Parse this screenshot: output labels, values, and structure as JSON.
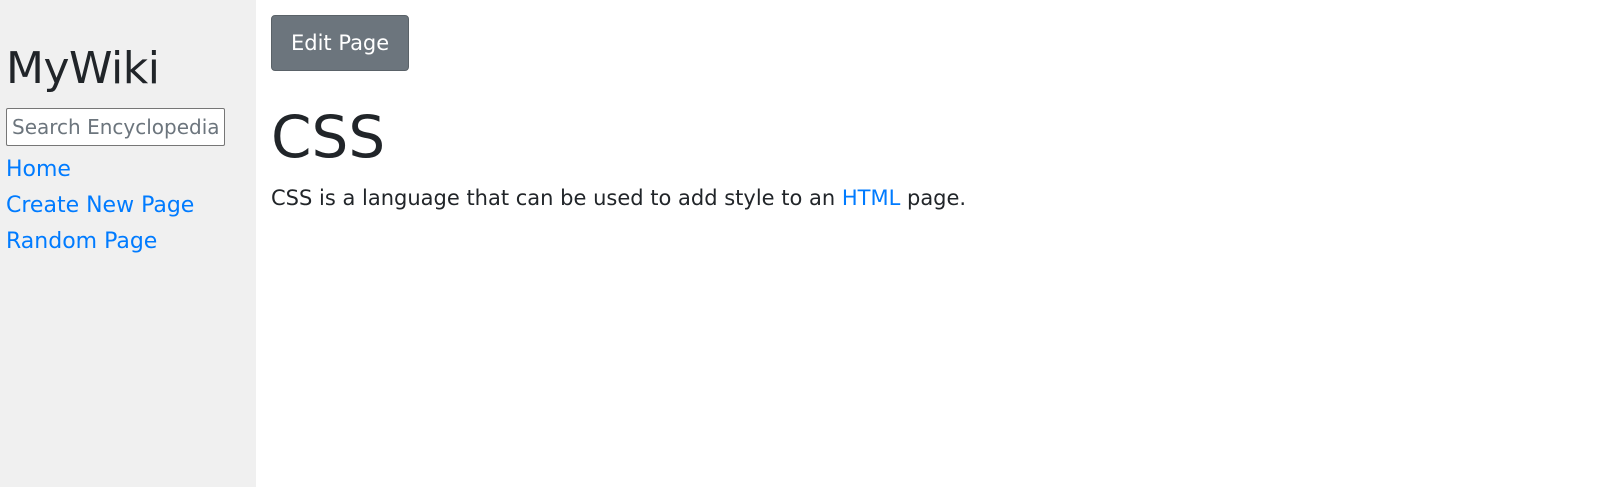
{
  "sidebar": {
    "site_title": "MyWiki",
    "search": {
      "placeholder": "Search Encyclopedia",
      "value": ""
    },
    "nav": [
      {
        "label": "Home"
      },
      {
        "label": "Create New Page"
      },
      {
        "label": "Random Page"
      }
    ]
  },
  "main": {
    "edit_button_label": "Edit Page",
    "page_title": "CSS",
    "body": {
      "before_link": "CSS is a language that can be used to add style to an ",
      "link_text": "HTML",
      "after_link": " page."
    }
  },
  "colors": {
    "sidebar_bg": "#f0f0f0",
    "link": "#007bff",
    "button_bg": "#6c757d",
    "text": "#212529"
  }
}
